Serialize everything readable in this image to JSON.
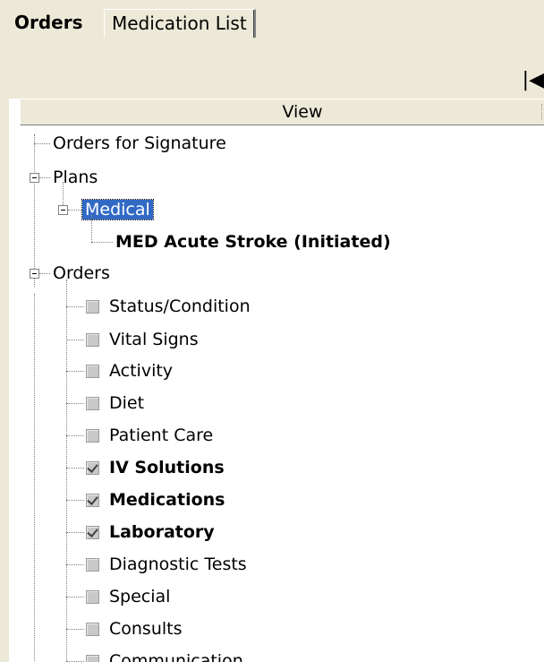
{
  "tabs": [
    {
      "label": "Orders",
      "active": true
    },
    {
      "label": "Medication List",
      "active": false
    }
  ],
  "toolbar": {
    "nav_icon": "first-page-icon",
    "nav_glyph": "|◀"
  },
  "view_header": "View",
  "tree": {
    "orders_for_signature": "Orders for Signature",
    "plans": {
      "label": "Plans",
      "medical": {
        "label": "Medical",
        "plan": "MED Acute Stroke (Initiated)"
      }
    },
    "orders": {
      "label": "Orders",
      "items": [
        {
          "label": "Status/Condition",
          "checked": false
        },
        {
          "label": "Vital Signs",
          "checked": false
        },
        {
          "label": "Activity",
          "checked": false
        },
        {
          "label": "Diet",
          "checked": false
        },
        {
          "label": "Patient Care",
          "checked": false
        },
        {
          "label": "IV Solutions",
          "checked": true
        },
        {
          "label": "Medications",
          "checked": true
        },
        {
          "label": "Laboratory",
          "checked": true
        },
        {
          "label": "Diagnostic Tests",
          "checked": false
        },
        {
          "label": "Special",
          "checked": false
        },
        {
          "label": "Consults",
          "checked": false
        },
        {
          "label": "Communication",
          "checked": false
        }
      ]
    }
  },
  "colors": {
    "selection": "#316ac5",
    "chrome": "#ece9d8"
  }
}
